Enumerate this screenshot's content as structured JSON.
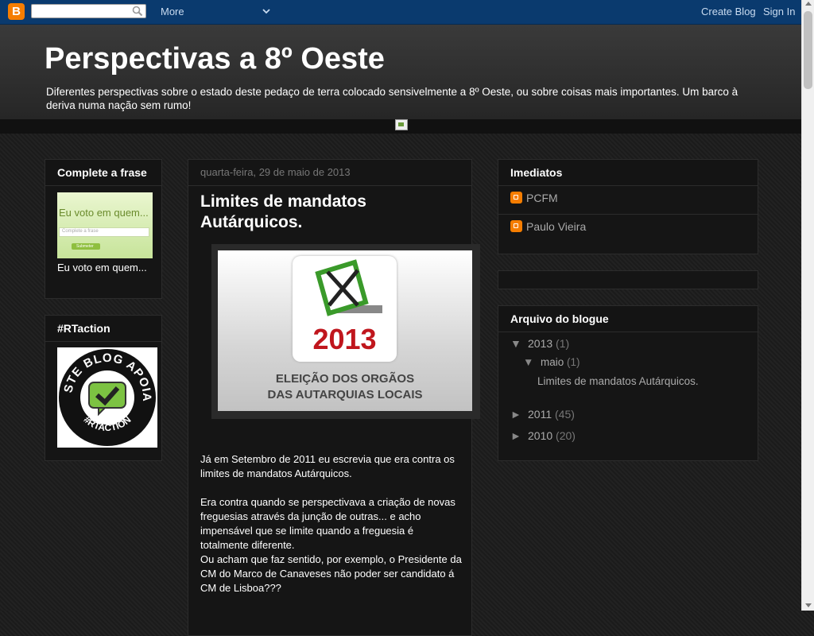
{
  "navbar": {
    "more_label": "More",
    "create_blog_label": "Create Blog",
    "sign_in_label": "Sign In",
    "search_placeholder": ""
  },
  "header": {
    "title": "Perspectivas a 8º Oeste",
    "description": "Diferentes perspectivas sobre o estado deste pedaço de terra colocado sensivelmente a 8º Oeste, ou sobre coisas mais importantes. Um barco à deriva numa nação sem rumo!"
  },
  "sidebar_left": {
    "frase": {
      "title": "Complete a frase",
      "image_text": "Eu voto em quem...",
      "image_input": "Complete a frase",
      "image_button": "Submeter",
      "caption": "Eu voto em quem..."
    },
    "rtaction": {
      "title": "#RTaction",
      "badge_top": "ESTE BLOG APOIA",
      "badge_bottom": "#RTACTION"
    }
  },
  "post": {
    "date": "quarta-feira, 29 de maio de 2013",
    "title": "Limites de mandatos Autárquicos.",
    "image_year": "2013",
    "image_caption_line1": "ELEIÇÃO DOS ORGÃOS",
    "image_caption_line2": "DAS AUTARQUIAS LOCAIS",
    "paragraphs": [
      "Já em Setembro de 2011 eu escrevia que era contra os limites de mandatos Autárquicos.",
      "Era contra quando se perspectivava a criação de novas freguesias através da junção de outras... e acho impensável que se limite quando a freguesia é totalmente diferente.",
      "Ou acham que faz sentido, por exemplo, o Presidente da CM do Marco de Canaveses não poder ser candidato á CM de Lisboa???"
    ]
  },
  "sidebar_right": {
    "imediatos": {
      "title": "Imediatos",
      "links": [
        "PCFM",
        "Paulo Vieira"
      ]
    },
    "arquivo": {
      "title": "Arquivo do blogue",
      "items": [
        {
          "toggle": "▼",
          "label": "2013",
          "count": "(1)"
        },
        {
          "toggle": "▼",
          "label": "maio",
          "count": "(1)"
        },
        {
          "label": "Limites de mandatos Autárquicos."
        },
        {
          "toggle": "►",
          "label": "2011",
          "count": "(45)"
        },
        {
          "toggle": "►",
          "label": "2010",
          "count": "(20)"
        }
      ]
    }
  },
  "colors": {
    "navbar": "#0a3a6e",
    "blogger_orange": "#f57d00",
    "background": "#1e1e1e"
  }
}
